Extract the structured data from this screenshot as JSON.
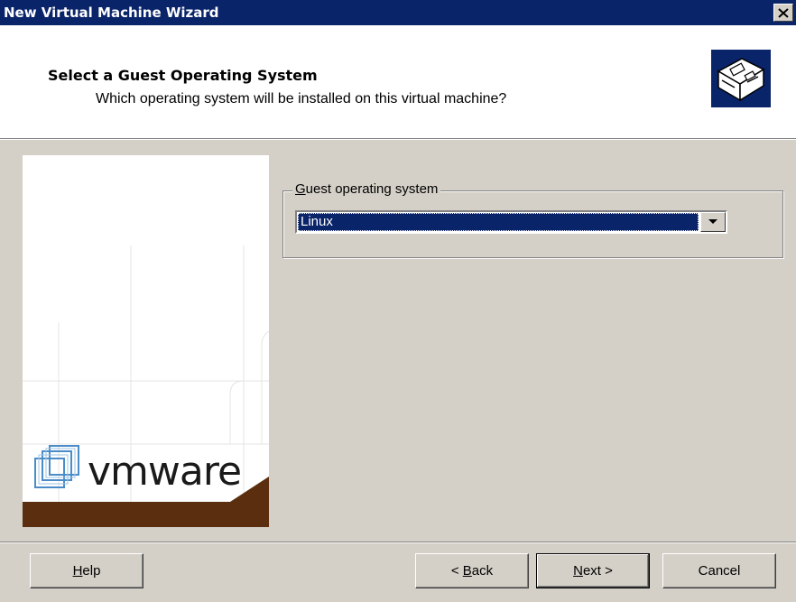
{
  "window": {
    "title": "New Virtual Machine Wizard",
    "close_label": "×"
  },
  "header": {
    "title": "Select a Guest Operating System",
    "subtitle": "Which operating system will be installed on this virtual machine?",
    "icon": "computer-hardware-icon"
  },
  "side_panel": {
    "brand": "vmware",
    "logo_icon": "vmware-squares-logo"
  },
  "guest_os": {
    "group_label_mnemonic": "G",
    "group_label_rest": "uest operating system",
    "selected": "Linux"
  },
  "buttons": {
    "help": {
      "mnemonic": "H",
      "rest": "elp"
    },
    "back": {
      "prefix": "< ",
      "mnemonic": "B",
      "rest": "ack"
    },
    "next": {
      "mnemonic": "N",
      "rest": "ext >"
    },
    "cancel": "Cancel"
  },
  "colors": {
    "titlebar": "#0a246a",
    "dialog_bg": "#d4d0c8",
    "selection": "#0a246a",
    "brand_bar": "#5a2e0e"
  }
}
